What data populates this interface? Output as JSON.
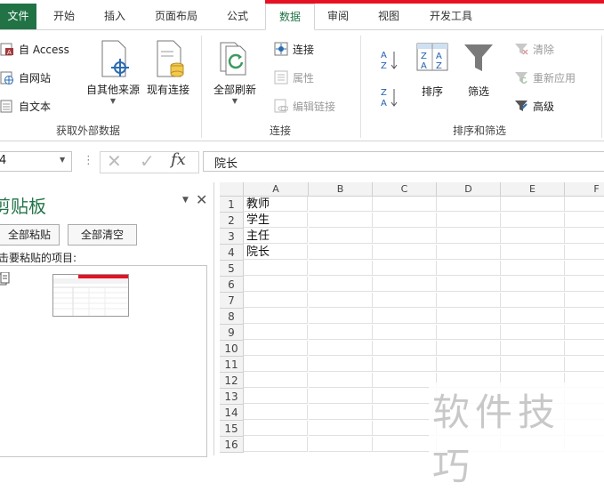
{
  "tabs": [
    "文件",
    "开始",
    "插入",
    "页面布局",
    "公式",
    "数据",
    "审阅",
    "视图",
    "开发工具"
  ],
  "active_tab": "数据",
  "colors": {
    "accent": "#217346",
    "red_strip": "#e81123"
  },
  "ribbon": {
    "get_external": {
      "access": "自 Access",
      "web": "自网站",
      "text": "自文本",
      "other_sources": "自其他来源",
      "existing": "现有连接",
      "label": "获取外部数据"
    },
    "connections": {
      "refresh_all": "全部刷新",
      "connections": "连接",
      "properties": "属性",
      "edit_links": "编辑链接",
      "label": "连接"
    },
    "sort_filter": {
      "sort": "排序",
      "filter": "筛选",
      "clear": "清除",
      "reapply": "重新应用",
      "advanced": "高级",
      "label": "排序和筛选"
    }
  },
  "formula_bar": {
    "name_box": "4",
    "cancel": "✕",
    "enter": "✓",
    "fx": "fx",
    "value": "院长"
  },
  "clipboard": {
    "title": "剪贴板",
    "paste_all": "全部粘贴",
    "clear_all": "全部清空",
    "hint": "击要粘贴的项目:"
  },
  "sheet": {
    "columns": [
      "A",
      "B",
      "C",
      "D",
      "E",
      "F"
    ],
    "rows": [
      "1",
      "2",
      "3",
      "4",
      "5",
      "6",
      "7",
      "8",
      "9",
      "10",
      "11",
      "12",
      "13",
      "14",
      "15",
      "16"
    ],
    "col_a_values": [
      "教师",
      "学生",
      "主任",
      "院长"
    ]
  },
  "watermark": "软件技巧"
}
